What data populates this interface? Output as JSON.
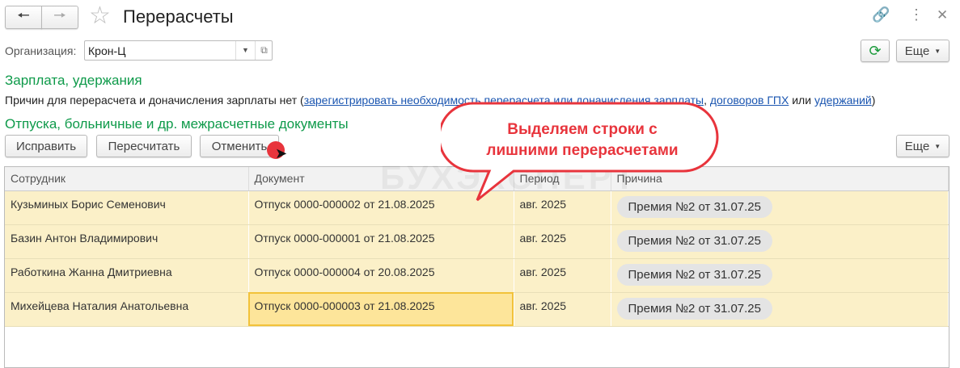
{
  "header": {
    "title": "Перерасчеты",
    "back_icon": "arrow-left",
    "forward_icon": "arrow-right"
  },
  "org": {
    "label": "Организация:",
    "value": "Крон-Ц"
  },
  "toolbar": {
    "more": "Еще"
  },
  "salary": {
    "heading": "Зарплата, удержания",
    "text": "Причин для перерасчета и доначисления зарплаты нет (",
    "link1": "зарегистрировать необходимость перерасчета или доначисления зарплаты",
    "sep": ", ",
    "link2": "договоров ГПХ",
    "or": " или ",
    "link3": "удержаний",
    "close": ")"
  },
  "vacations": {
    "heading": "Отпуска, больничные и др. межрасчетные документы",
    "fix": "Исправить",
    "recalc": "Пересчитать",
    "cancel": "Отменить",
    "more": "Еще"
  },
  "table": {
    "columns": [
      "Сотрудник",
      "Документ",
      "Период",
      "Причина"
    ],
    "rows": [
      [
        "Кузьминых Борис Семенович",
        "Отпуск 0000-000002 от 21.08.2025",
        "авг. 2025",
        "Премия №2 от 31.07.25"
      ],
      [
        "Базин Антон Владимирович",
        "Отпуск 0000-000001 от 21.08.2025",
        "авг. 2025",
        "Премия №2 от 31.07.25"
      ],
      [
        "Работкина Жанна Дмитриевна",
        "Отпуск 0000-000004 от 20.08.2025",
        "авг. 2025",
        "Премия №2 от 31.07.25"
      ],
      [
        "Михейцева Наталия Анатольевна",
        "Отпуск 0000-000003 от 21.08.2025",
        "авг. 2025",
        "Премия №2 от 31.07.25"
      ]
    ]
  },
  "callout": {
    "line1": "Выделяем строки с",
    "line2": "лишними перерасчетами"
  },
  "watermark": "БУХЭКСПЕРТ"
}
